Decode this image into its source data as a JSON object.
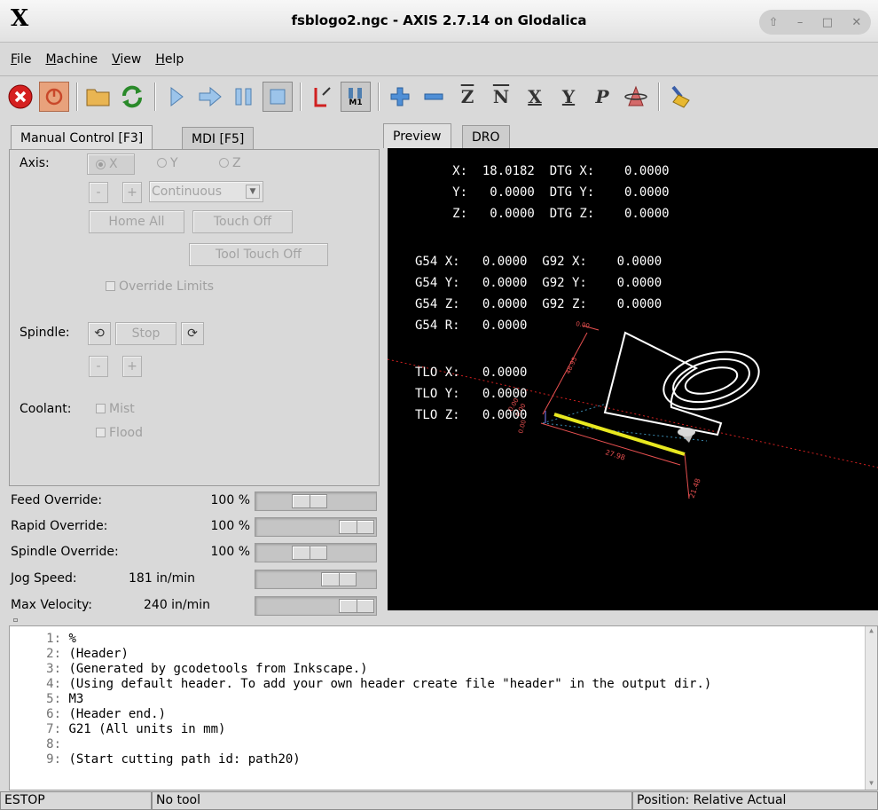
{
  "window": {
    "title": "fsblogo2.ngc - AXIS 2.7.14 on Glodalica",
    "logo": "X"
  },
  "menu": [
    "File",
    "Machine",
    "View",
    "Help"
  ],
  "toolbar": {
    "icons": [
      "estop-icon",
      "power-icon",
      "open-folder-icon",
      "reload-icon",
      "run-icon",
      "step-icon",
      "pause-icon",
      "stop-icon",
      "run-from-line-icon",
      "optional-stop-icon",
      "zoom-in-icon",
      "zoom-out-icon",
      "view-z-icon",
      "view-z-rotated-icon",
      "view-x-icon",
      "view-y-icon",
      "view-p-icon",
      "rotate-view-icon",
      "clear-live-plot-icon"
    ],
    "view_z": "Z",
    "view_z2": "N",
    "view_x": "X",
    "view_y": "Y",
    "view_p": "P",
    "optional_stop": "M1"
  },
  "tabs_left": {
    "manual": "Manual Control [F3]",
    "mdi": "MDI [F5]"
  },
  "tabs_right": {
    "preview": "Preview",
    "dro": "DRO"
  },
  "manual": {
    "axis_label": "Axis:",
    "axis_x": "X",
    "axis_y": "Y",
    "axis_z": "Z",
    "jog_minus": "-",
    "jog_plus": "+",
    "jog_mode": "Continuous",
    "home_all": "Home All",
    "touch_off": "Touch Off",
    "tool_touch_off": "Tool Touch Off",
    "override_limits": "Override Limits",
    "spindle_label": "Spindle:",
    "spindle_stop": "Stop",
    "spindle_minus": "-",
    "spindle_plus": "+",
    "coolant_label": "Coolant:",
    "mist": "Mist",
    "flood": "Flood"
  },
  "sliders": [
    {
      "name": "Feed Override:",
      "value": "100 %",
      "position": 0.42
    },
    {
      "name": "Rapid Override:",
      "value": "100 %",
      "position": 1.0
    },
    {
      "name": "Spindle Override:",
      "value": "100 %",
      "position": 0.42
    },
    {
      "name": "Jog Speed:",
      "value": "181 in/min",
      "position": 0.78
    },
    {
      "name": "Max Velocity:",
      "value": "240 in/min",
      "position": 1.0
    }
  ],
  "dro": {
    "r1": "     X:  18.0182  DTG X:    0.0000",
    "r2": "     Y:   0.0000  DTG Y:    0.0000",
    "r3": "     Z:   0.0000  DTG Z:    0.0000",
    "r4": "G54 X:   0.0000  G92 X:    0.0000",
    "r5": "G54 Y:   0.0000  G92 Y:    0.0000",
    "r6": "G54 Z:   0.0000  G92 Z:    0.0000",
    "r7": "G54 R:   0.0000",
    "r8": "TLO X:   0.0000",
    "r9": "TLO Y:   0.0000",
    "r10": "TLO Z:   0.0000"
  },
  "plot_labels": {
    "d1": "27.98",
    "d2": "21.48",
    "d3": "0.00",
    "d4": "0.00",
    "d5": "0.00",
    "d6": "48.95",
    "d7": "0.00"
  },
  "gcode": [
    {
      "n": "1:",
      "text": "%"
    },
    {
      "n": "2:",
      "text": "(Header)"
    },
    {
      "n": "3:",
      "text": "(Generated by gcodetools from Inkscape.)"
    },
    {
      "n": "4:",
      "text": "(Using default header. To add your own header create file \"header\" in the output dir.)"
    },
    {
      "n": "5:",
      "text": "M3"
    },
    {
      "n": "6:",
      "text": "(Header end.)"
    },
    {
      "n": "7:",
      "text": "G21 (All units in mm)"
    },
    {
      "n": "8:",
      "text": ""
    },
    {
      "n": "9:",
      "text": "(Start cutting path id: path20)"
    }
  ],
  "status": {
    "estop": "ESTOP",
    "tool": "No tool",
    "position": "Position: Relative Actual"
  }
}
